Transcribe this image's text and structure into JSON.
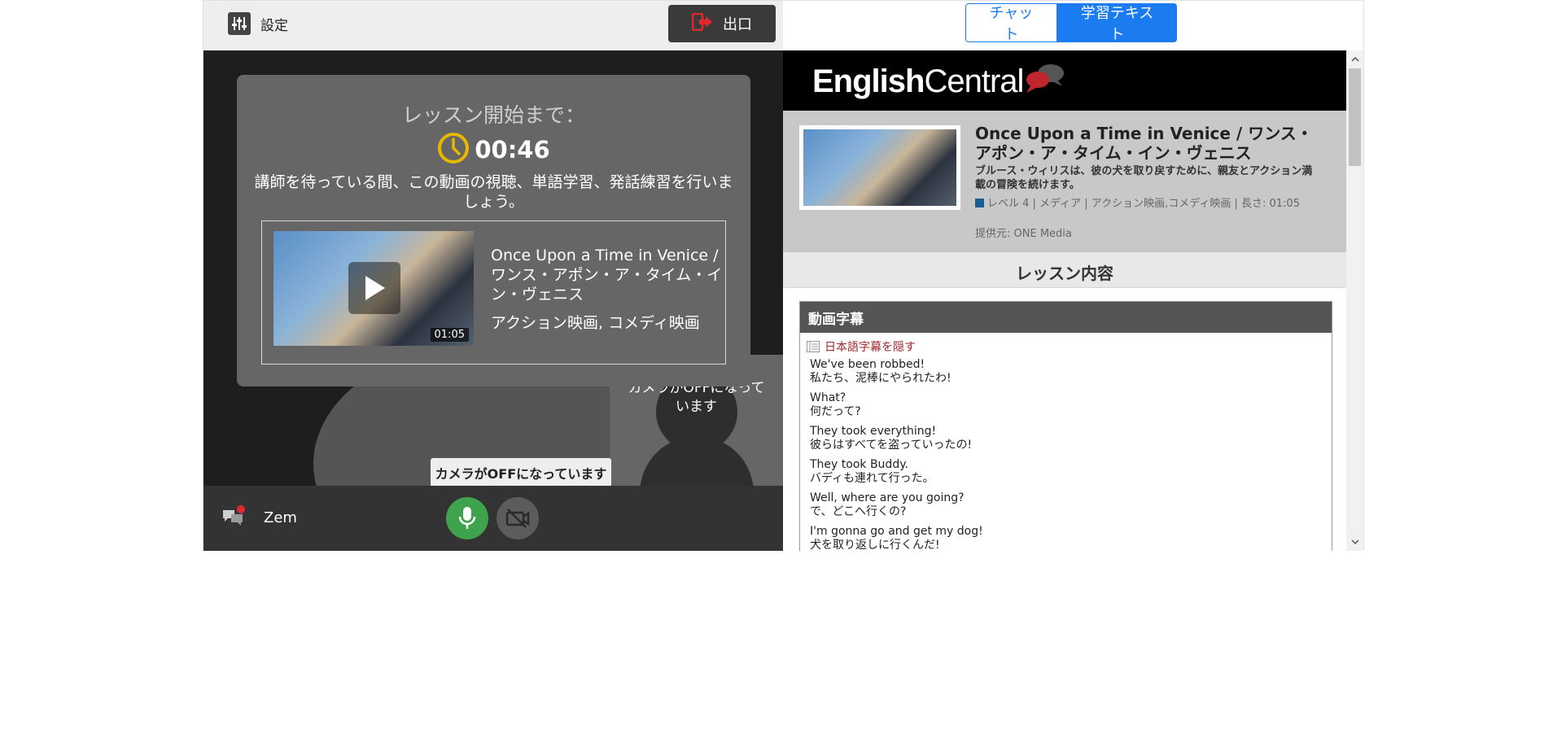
{
  "header": {
    "settings_label": "設定",
    "exit_label": "出口"
  },
  "countdown": {
    "title": "レッスン開始まで：",
    "timer": "00:46",
    "message": "講師を待っている間、この動画の視聴、単語学習、発話練習を行いましょう。"
  },
  "video": {
    "title": "Once Upon a Time in Venice / ワンス・アポン・ア・タイム・イン・ヴェニス",
    "genre": "アクション映画, コメディ映画",
    "duration": "01:05"
  },
  "self_cam": {
    "status_text": "カメラがOFFになっています"
  },
  "tooltip": {
    "text": "カメラがOFFになっています"
  },
  "bottom_bar": {
    "user_name": "Zem"
  },
  "tabs": [
    {
      "label": "チャット",
      "active": false
    },
    {
      "label": "学習テキスト",
      "active": true
    }
  ],
  "brand": {
    "logo_bold": "English",
    "logo_light": "Central"
  },
  "lesson_info": {
    "title": "Once Upon a Time in Venice / ワンス・アポン・ア・タイム・イン・ヴェニス",
    "description": "ブルース・ウィリスは、彼の犬を取り戻すために、親友とアクション満載の冒険を続けます。",
    "meta": "レベル 4 | メディア | アクション映画,コメディ映画 | 長さ: 01:05",
    "provider": "提供元: ONE Media"
  },
  "section": {
    "title": "レッスン内容"
  },
  "subtitles": {
    "header": "動画字幕",
    "hide_jp_label": "日本語字幕を隠す",
    "lines": [
      {
        "en": "We've been robbed!",
        "jp": "私たち、泥棒にやられたわ!"
      },
      {
        "en": "What?",
        "jp": "何だって?"
      },
      {
        "en": "They took everything!",
        "jp": "彼らはすべてを盗っていったの!"
      },
      {
        "en": "They took Buddy.",
        "jp": "バディも連れて行った。"
      },
      {
        "en": "Well, where are you going?",
        "jp": "で、どこへ行くの?"
      },
      {
        "en": "I'm gonna go and get my dog!",
        "jp": "犬を取り返しに行くんだ!"
      }
    ]
  },
  "colors": {
    "accent": "#1a7cf0",
    "mic_green": "#3fa34d",
    "timer_yellow": "#e6b800",
    "exit_red": "#e0282f"
  }
}
